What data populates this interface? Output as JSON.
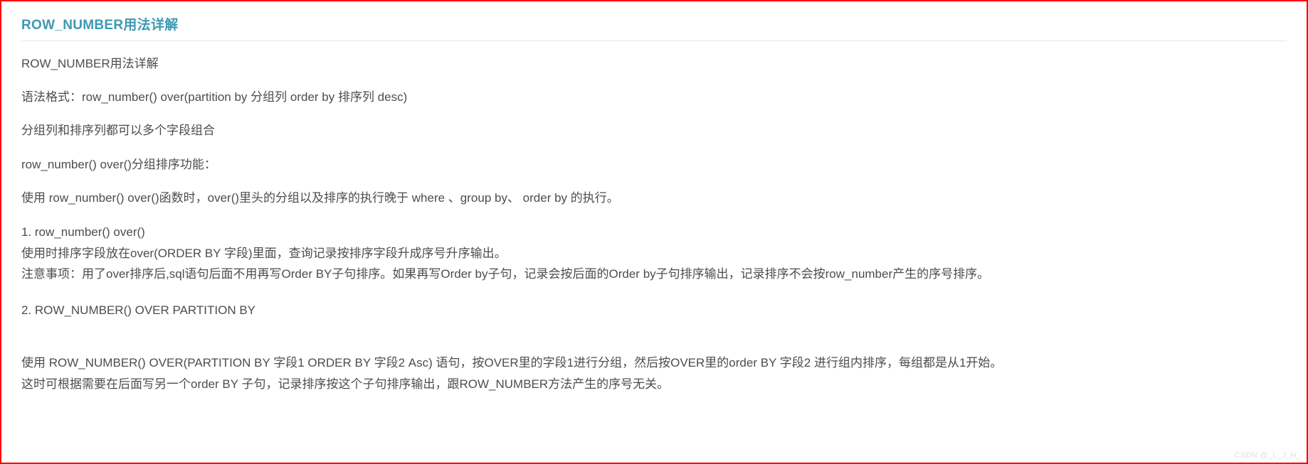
{
  "title": "ROW_NUMBER用法详解",
  "p1": "ROW_NUMBER用法详解",
  "p2": "语法格式：row_number() over(partition by 分组列 order by 排序列 desc)",
  "p3": "分组列和排序列都可以多个字段组合",
  "p4": "row_number() over()分组排序功能：",
  "p5": "使用 row_number() over()函数时，over()里头的分组以及排序的执行晚于 where 、group by、 order by 的执行。",
  "block1": {
    "l1": "1. row_number() over()",
    "l2": "使用时排序字段放在over(ORDER BY 字段)里面，查询记录按排序字段升成序号升序输出。",
    "l3": "注意事项：用了over排序后,sql语句后面不用再写Order BY子句排序。如果再写Order by子句，记录会按后面的Order by子句排序输出，记录排序不会按row_number产生的序号排序。"
  },
  "p6": "2. ROW_NUMBER() OVER PARTITION BY",
  "block2": {
    "l1": "使用 ROW_NUMBER() OVER(PARTITION BY 字段1 ORDER BY 字段2 Asc) 语句，按OVER里的字段1进行分组，然后按OVER里的order BY 字段2 进行组内排序，每组都是从1开始。",
    "l2": "这时可根据需要在后面写另一个order BY 子句，记录排序按这个子句排序输出，跟ROW_NUMBER方法产生的序号无关。"
  },
  "watermark": "CSDN @_L_J_H_"
}
